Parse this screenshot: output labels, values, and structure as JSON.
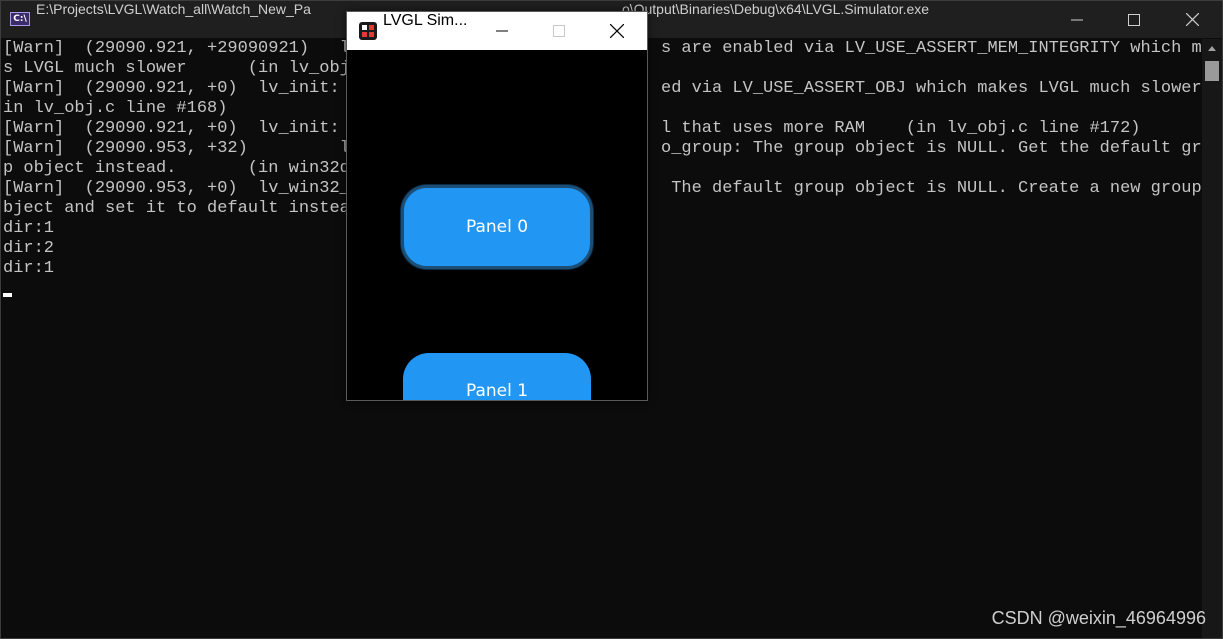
{
  "console": {
    "icon_text": "C:\\",
    "title": "E:\\Projects\\LVGL\\Watch_all\\Watch_New_Pa",
    "title_tail": "o\\Output\\Binaries\\Debug\\x64\\LVGL.Simulator.exe",
    "lines": [
      "[Warn]  (29090.921, +29090921)   lv",
      "s LVGL much slower      (in lv_obj.",
      "[Warn]  (29090.921, +0)  lv_init: C",
      "in lv_obj.c line #168)",
      "[Warn]  (29090.921, +0)  lv_init: S",
      "[Warn]  (29090.953, +32)         lv",
      "p object instead.       (in win32dr",
      "[Warn]  (29090.953, +0)  lv_win32_a",
      "bject and set it to default insteac",
      "dir:1",
      "dir:2",
      "dir:1"
    ],
    "right_lines": [
      "s are enabled via LV_USE_ASSERT_MEM_INTEGRITY which make",
      "",
      "ed via LV_USE_ASSERT_OBJ which makes LVGL much slower  (",
      "",
      "l that uses more RAM    (in lv_obj.c line #172)",
      "o_group: The group object is NULL. Get the default grou",
      "",
      " The default group object is NULL. Create a new group o",
      "",
      "",
      "",
      ""
    ],
    "watermark": "CSDN @weixin_46964996",
    "icons": {
      "minimize": "minimize-icon",
      "maximize": "maximize-icon",
      "close": "close-icon"
    }
  },
  "simulator": {
    "title": "LVGL Sim...",
    "panels": [
      {
        "label": "Panel 0",
        "focused": true
      },
      {
        "label": "Panel 1",
        "focused": false
      }
    ],
    "colors": {
      "panel": "#2196f3",
      "focus_border": "#1b4f78",
      "screen": "#000000"
    }
  }
}
